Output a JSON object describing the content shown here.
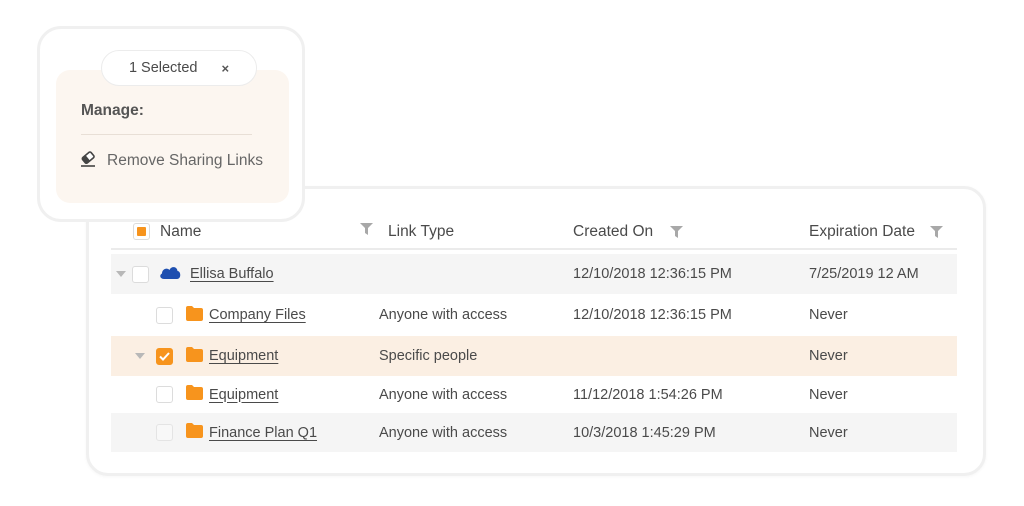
{
  "selection_popup": {
    "selected_label": "1 Selected",
    "close_icon": "×",
    "manage_label": "Manage:",
    "actions": [
      {
        "label": "Remove Sharing Links",
        "icon": "eraser-icon"
      }
    ]
  },
  "grid": {
    "columns": [
      {
        "key": "name",
        "label": "Name"
      },
      {
        "key": "link_type",
        "label": "Link Type"
      },
      {
        "key": "created_on",
        "label": "Created On"
      },
      {
        "key": "expiration_date",
        "label": "Expiration Date"
      }
    ],
    "rows": [
      {
        "name": "Ellisa Buffalo",
        "icon": "onedrive-cloud-icon",
        "link_type": "",
        "created_on": "12/10/2018 12:36:15 PM",
        "expiration_date": "7/25/2019 12 AM",
        "expanded": true,
        "checked": false
      },
      {
        "name": "Company Files",
        "icon": "folder-icon",
        "link_type": "Anyone with access",
        "created_on": "12/10/2018 12:36:15 PM",
        "expiration_date": "Never",
        "checked": false
      },
      {
        "name": "Equipment",
        "icon": "folder-icon",
        "link_type": "Specific people",
        "created_on": "",
        "expiration_date": "Never",
        "expanded": true,
        "checked": true
      },
      {
        "name": "Equipment",
        "icon": "folder-icon",
        "link_type": "Anyone with access",
        "created_on": "11/12/2018 1:54:26 PM",
        "expiration_date": "Never",
        "checked": false
      },
      {
        "name": "Finance Plan Q1",
        "icon": "folder-icon",
        "link_type": "Anyone with access",
        "created_on": "10/3/2018 1:45:29 PM",
        "expiration_date": "Never",
        "checked": false
      }
    ]
  },
  "colors": {
    "accent": "#f7941d",
    "selected_row": "#fbefe3",
    "popup_bg": "#fcf6f0",
    "onedrive_blue": "#1e4fb0"
  }
}
